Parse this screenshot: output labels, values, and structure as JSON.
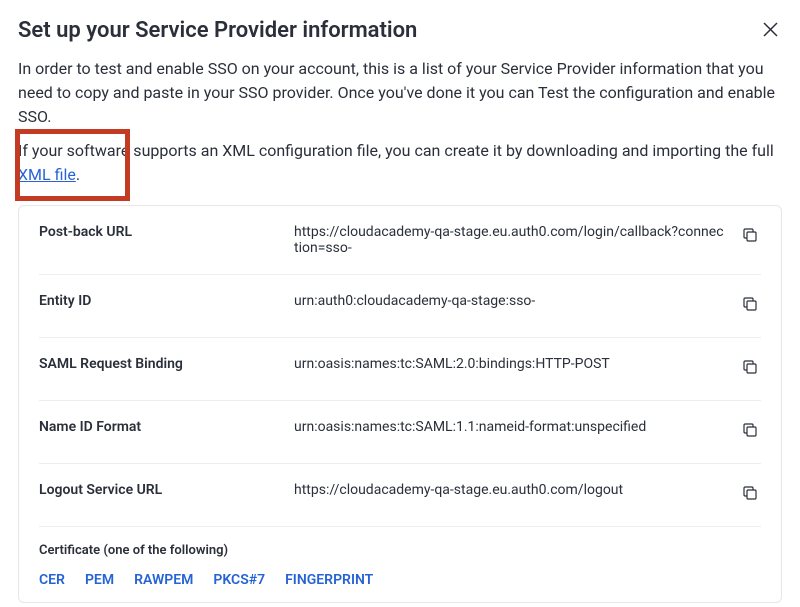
{
  "title": "Set up your Service Provider information",
  "description": "In order to test and enable SSO on your account, this is a list of your Service Provider information that you need to copy and paste in your SSO provider. Once you've done it you can Test the configuration and enable SSO.",
  "xml_text_before": "If your software supports an XML configuration file, you can create it by downloading and importing the full ",
  "xml_link_text": "XML file",
  "xml_text_after": ".",
  "rows": [
    {
      "label": "Post-back URL",
      "value": "https://cloudacademy-qa-stage.eu.auth0.com/login/callback?connection=sso-"
    },
    {
      "label": "Entity ID",
      "value": "urn:auth0:cloudacademy-qa-stage:sso-"
    },
    {
      "label": "SAML Request Binding",
      "value": "urn:oasis:names:tc:SAML:2.0:bindings:HTTP-POST"
    },
    {
      "label": "Name ID Format",
      "value": "urn:oasis:names:tc:SAML:1.1:nameid-format:unspecified"
    },
    {
      "label": "Logout Service URL",
      "value": "https://cloudacademy-qa-stage.eu.auth0.com/logout"
    }
  ],
  "cert_label": "Certificate (one of the following)",
  "cert_links": [
    "CER",
    "PEM",
    "RAWPEM",
    "PKCS#7",
    "FINGERPRINT"
  ]
}
